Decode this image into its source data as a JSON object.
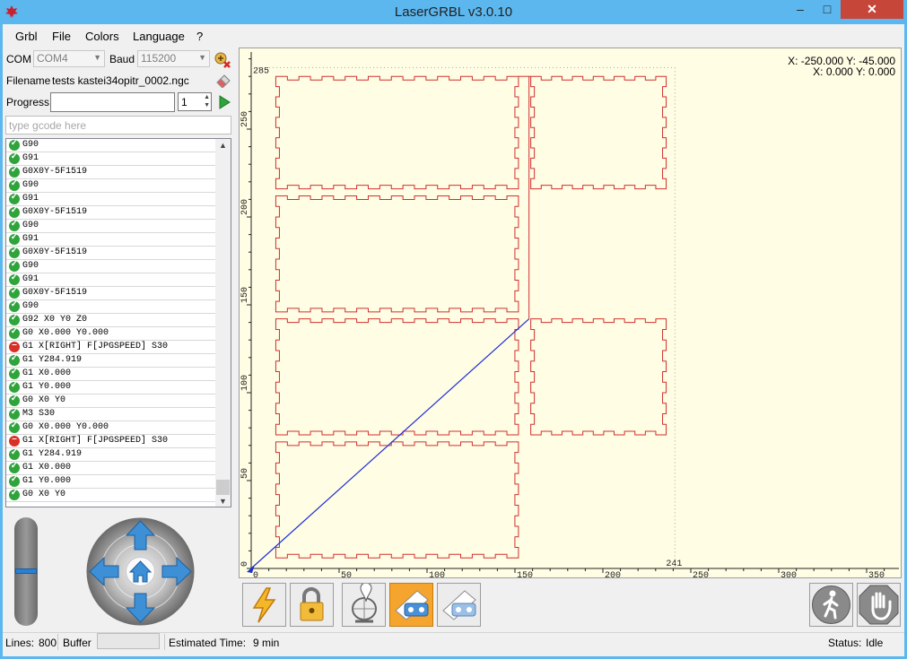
{
  "window": {
    "title": "LaserGRBL v3.0.10",
    "minimize_label": "–",
    "maximize_label": "□",
    "close_label": "✕",
    "icon": "laser-maple-icon"
  },
  "menu": [
    "Grbl",
    "File",
    "Colors",
    "Language",
    "?"
  ],
  "connection": {
    "com_label": "COM",
    "com_value": "COM4",
    "baud_label": "Baud",
    "baud_value": "115200",
    "connect_icon": "disconnected-plug-icon"
  },
  "file": {
    "filename_label": "Filename",
    "filename_value": "tests kastei34opitr_0002.ngc",
    "open_icon": "eraser-open-icon"
  },
  "progress": {
    "label": "Progress",
    "value": 0,
    "copies": "1",
    "run_icon": "play-icon"
  },
  "console": {
    "placeholder": "type gcode here"
  },
  "gcode_lines": [
    {
      "status": "ok",
      "text": "G90"
    },
    {
      "status": "ok",
      "text": "G91"
    },
    {
      "status": "ok",
      "text": "G0X0Y-5F1519"
    },
    {
      "status": "ok",
      "text": "G90"
    },
    {
      "status": "ok",
      "text": "G91"
    },
    {
      "status": "ok",
      "text": "G0X0Y-5F1519"
    },
    {
      "status": "ok",
      "text": "G90"
    },
    {
      "status": "ok",
      "text": "G91"
    },
    {
      "status": "ok",
      "text": "G0X0Y-5F1519"
    },
    {
      "status": "ok",
      "text": "G90"
    },
    {
      "status": "ok",
      "text": "G91"
    },
    {
      "status": "ok",
      "text": "G0X0Y-5F1519"
    },
    {
      "status": "ok",
      "text": "G90"
    },
    {
      "status": "ok",
      "text": "G92 X0 Y0 Z0"
    },
    {
      "status": "ok",
      "text": "G0 X0.000 Y0.000"
    },
    {
      "status": "err",
      "text": "G1 X[RIGHT] F[JPGSPEED] S30"
    },
    {
      "status": "ok",
      "text": "G1 Y284.919"
    },
    {
      "status": "ok",
      "text": "G1 X0.000"
    },
    {
      "status": "ok",
      "text": "G1 Y0.000"
    },
    {
      "status": "ok",
      "text": "G0 X0 Y0"
    },
    {
      "status": "ok",
      "text": "M3 S30"
    },
    {
      "status": "ok",
      "text": "G0 X0.000 Y0.000"
    },
    {
      "status": "err",
      "text": "G1 X[RIGHT] F[JPGSPEED] S30"
    },
    {
      "status": "ok",
      "text": "G1 Y284.919"
    },
    {
      "status": "ok",
      "text": "G1 X0.000"
    },
    {
      "status": "ok",
      "text": "G1 Y0.000"
    },
    {
      "status": "ok",
      "text": "G0 X0 Y0"
    }
  ],
  "jog": {
    "speed_level": 0.5,
    "home_icon": "home-icon",
    "up_icon": "arrow-up-icon",
    "down_icon": "arrow-down-icon",
    "left_icon": "arrow-left-icon",
    "right_icon": "arrow-right-icon"
  },
  "preview": {
    "coords_line1": "X: -250.000 Y: -45.000",
    "coords_line2": "X: 0.000 Y: 0.000",
    "x_ticks": [
      "0",
      "50",
      "100",
      "150",
      "200",
      "250",
      "300",
      "350"
    ],
    "y_ticks": [
      "0",
      "50",
      "100",
      "150",
      "200",
      "250"
    ],
    "x_extent_label": "241",
    "y_extent_label": "285",
    "colors": {
      "background": "#fffde4",
      "cut_path": "#d03030",
      "travel_path": "#1f2fd8"
    }
  },
  "toolbar": [
    "reset-lightning-icon",
    "unlock-padlock-icon",
    "globe-pin-icon",
    "burn-frame-icon",
    "simulate-icon"
  ],
  "actions": {
    "jog_icon": "walking-man-icon",
    "stop_icon": "stop-hand-icon"
  },
  "status": {
    "lines_label": "Lines:",
    "lines_value": "800",
    "buffer_label": "Buffer",
    "time_label": "Estimated Time:",
    "time_value": "9 min",
    "status_label": "Status:",
    "status_value": "Idle"
  }
}
